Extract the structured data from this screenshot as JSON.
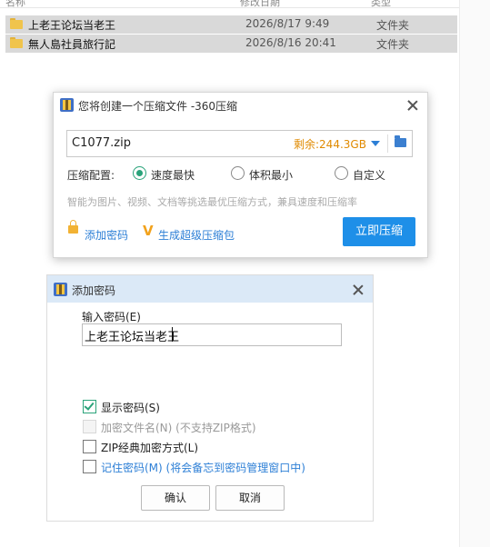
{
  "explorer": {
    "columns": [
      "名称",
      "修改日期",
      "类型"
    ],
    "files": [
      {
        "name": "上老王论坛当老王",
        "date": "2026/8/17 9:49",
        "type": "文件夹"
      },
      {
        "name": "無人島社員旅行記",
        "date": "2026/8/16 20:41",
        "type": "文件夹"
      }
    ]
  },
  "compress_dialog": {
    "title": "您将创建一个压缩文件 -360压缩",
    "path_value": "C1077.zip",
    "space_left": "剩余:244.3GB",
    "config_label": "压缩配置:",
    "options": [
      {
        "label": "速度最快",
        "selected": true
      },
      {
        "label": "体积最小",
        "selected": false
      },
      {
        "label": "自定义",
        "selected": false
      }
    ],
    "hint": "智能为图片、视频、文档等挑选最优压缩方式，兼具速度和压缩率",
    "add_password_link": "添加密码",
    "super_package_link": "生成超级压缩包",
    "compress_button": "立即压缩",
    "icons": {
      "title": "zip-archive-icon",
      "dropdown": "chevron-down-icon",
      "browse": "folder-icon",
      "lock": "lock-icon",
      "vip": "v-badge-icon"
    },
    "accent_color": "#1e8fe8"
  },
  "password_dialog": {
    "title": "添加密码",
    "input_label": "输入密码(E)",
    "input_value": "上老王论坛当老王",
    "checkboxes": [
      {
        "label": "显示密码(S)",
        "checked": true,
        "enabled": true
      },
      {
        "label": "加密文件名(N) (不支持ZIP格式)",
        "checked": false,
        "enabled": false
      },
      {
        "label": "ZIP经典加密方式(L)",
        "checked": false,
        "enabled": true
      },
      {
        "label": "记住密码(M) (将会备忘到密码管理窗口中)",
        "checked": false,
        "enabled": true
      }
    ],
    "ok_button": "确认",
    "cancel_button": "取消"
  }
}
